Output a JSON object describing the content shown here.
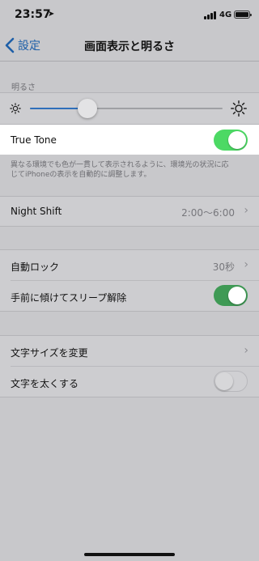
{
  "status_bar": {
    "time": "23:57",
    "network": "4G",
    "location_icon": "location-arrow-icon",
    "signal_icon": "signal-bars-icon",
    "battery_icon": "battery-icon"
  },
  "nav": {
    "back_label": "設定",
    "title": "画面表示と明るさ"
  },
  "brightness": {
    "header": "明るさ",
    "level": 0.3,
    "low_icon": "sun-small-icon",
    "high_icon": "sun-large-icon"
  },
  "true_tone": {
    "label": "True Tone",
    "on": true,
    "footer_line1": "異なる環境でも色が一貫して表示されるように、環境光の状況に応",
    "footer_line2": "じてiPhoneの表示を自動的に調整します。"
  },
  "night_shift": {
    "label": "Night Shift",
    "value": "2:00〜6:00"
  },
  "lock": {
    "auto_lock_label": "自動ロック",
    "auto_lock_value": "30秒",
    "raise_to_wake_label": "手前に傾けてスリープ解除",
    "raise_to_wake_on": true
  },
  "text": {
    "text_size_label": "文字サイズを変更",
    "bold_text_label": "文字を太くする",
    "bold_text_on": false
  },
  "colors": {
    "accent": "#1e5fa8",
    "toggle_on": "#4cd964",
    "dim_overlay": "#c8c8cb"
  }
}
